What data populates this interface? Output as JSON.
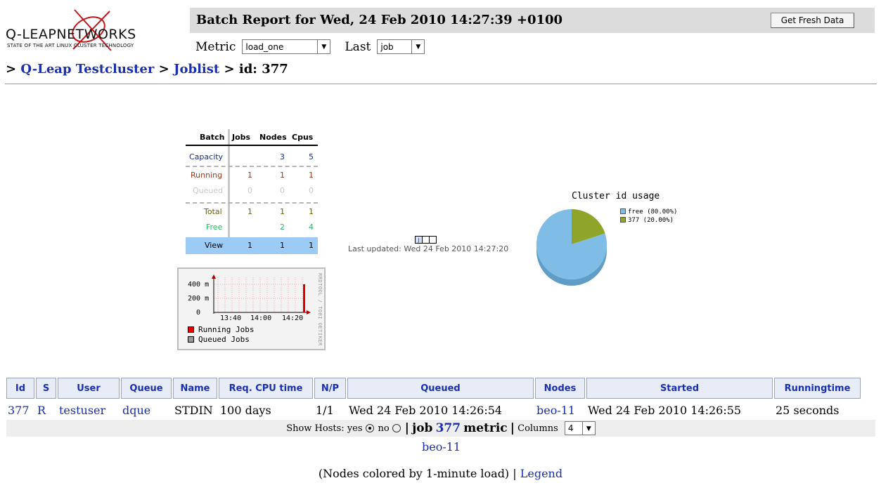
{
  "logo": {
    "brand": "Q-LEAPNETWORKS",
    "tagline": "STATE OF THE ART LINUX CLUSTER TECHNOLOGY"
  },
  "header": {
    "title": "Batch Report for Wed, 24 Feb 2010 14:27:39 +0100",
    "refresh_button": "Get Fresh Data"
  },
  "controls": {
    "metric_label": "Metric",
    "metric_value": "load_one",
    "last_label": "Last",
    "last_value": "job"
  },
  "breadcrumb": {
    "prefix": ">",
    "cluster": "Q-Leap Testcluster",
    "sep1": ">",
    "joblist": "Joblist",
    "sep2": ">",
    "current": "id: 377"
  },
  "summary": {
    "headers": [
      "Batch",
      "Jobs",
      "Nodes",
      "Cpus"
    ],
    "capacity": {
      "label": "Capacity",
      "jobs": "",
      "nodes": "3",
      "cpus": "5"
    },
    "running": {
      "label": "Running",
      "jobs": "1",
      "nodes": "1",
      "cpus": "1"
    },
    "queued": {
      "label": "Queued",
      "jobs": "0",
      "nodes": "0",
      "cpus": "0"
    },
    "total": {
      "label": "Total",
      "jobs": "1",
      "nodes": "1",
      "cpus": "1"
    },
    "free": {
      "label": "Free",
      "jobs": "",
      "nodes": "2",
      "cpus": "4"
    },
    "view": {
      "label": "View",
      "jobs": "1",
      "nodes": "1",
      "cpus": "1"
    },
    "colors": {
      "capacity": "#1a2f8a",
      "running": "#a0361a",
      "queued": "#c8c8c8",
      "total": "#6b6200",
      "free": "#1fbf5e",
      "view_bg": "#9ccbf5"
    }
  },
  "minigraph": {
    "y_ticks": [
      "400 m",
      "200 m",
      "0"
    ],
    "x_ticks": [
      "13:40",
      "14:00",
      "14:20"
    ],
    "legend": [
      {
        "label": "Running Jobs",
        "color": "#e00000"
      },
      {
        "label": "Queued Jobs",
        "color": "#999999"
      }
    ],
    "watermark": "RRDTOOL / TOBI OETIKER",
    "running_level": 400
  },
  "jobmap": {
    "cells": [
      "J",
      "",
      ""
    ]
  },
  "last_updated": "Last updated: Wed 24 Feb 2010 14:27:20",
  "pie": {
    "title": "Cluster id usage",
    "slices": [
      {
        "label": "free (80.00%)",
        "value": 80,
        "color": "#7fbde6"
      },
      {
        "label": "377 (20.00%)",
        "value": 20,
        "color": "#8ea52a"
      }
    ]
  },
  "jobtable": {
    "headers": [
      "Id",
      "S",
      "User",
      "Queue",
      "Name",
      "Req. CPU time",
      "N/P",
      "Queued",
      "Nodes",
      "Started",
      "Runningtime"
    ],
    "row": {
      "id": "377",
      "state": "R",
      "user": "testuser",
      "queue": "dque",
      "name": "STDIN",
      "req_cpu": "100 days",
      "np": "1/1",
      "queued": "Wed 24 Feb 2010 14:26:54",
      "nodes": "beo-11",
      "started": "Wed 24 Feb 2010 14:26:55",
      "runningtime": "25 seconds"
    }
  },
  "hostsbar": {
    "show_hosts": "Show Hosts:",
    "yes": "yes",
    "no": "no",
    "sep1": "|",
    "job_word": "job",
    "job_id": "377",
    "metric_word": "metric",
    "sep2": "|",
    "columns_label": "Columns",
    "columns_value": "4"
  },
  "host": "beo-11",
  "footer": {
    "text": "(Nodes colored by 1-minute load) |",
    "legend_link": "Legend"
  }
}
